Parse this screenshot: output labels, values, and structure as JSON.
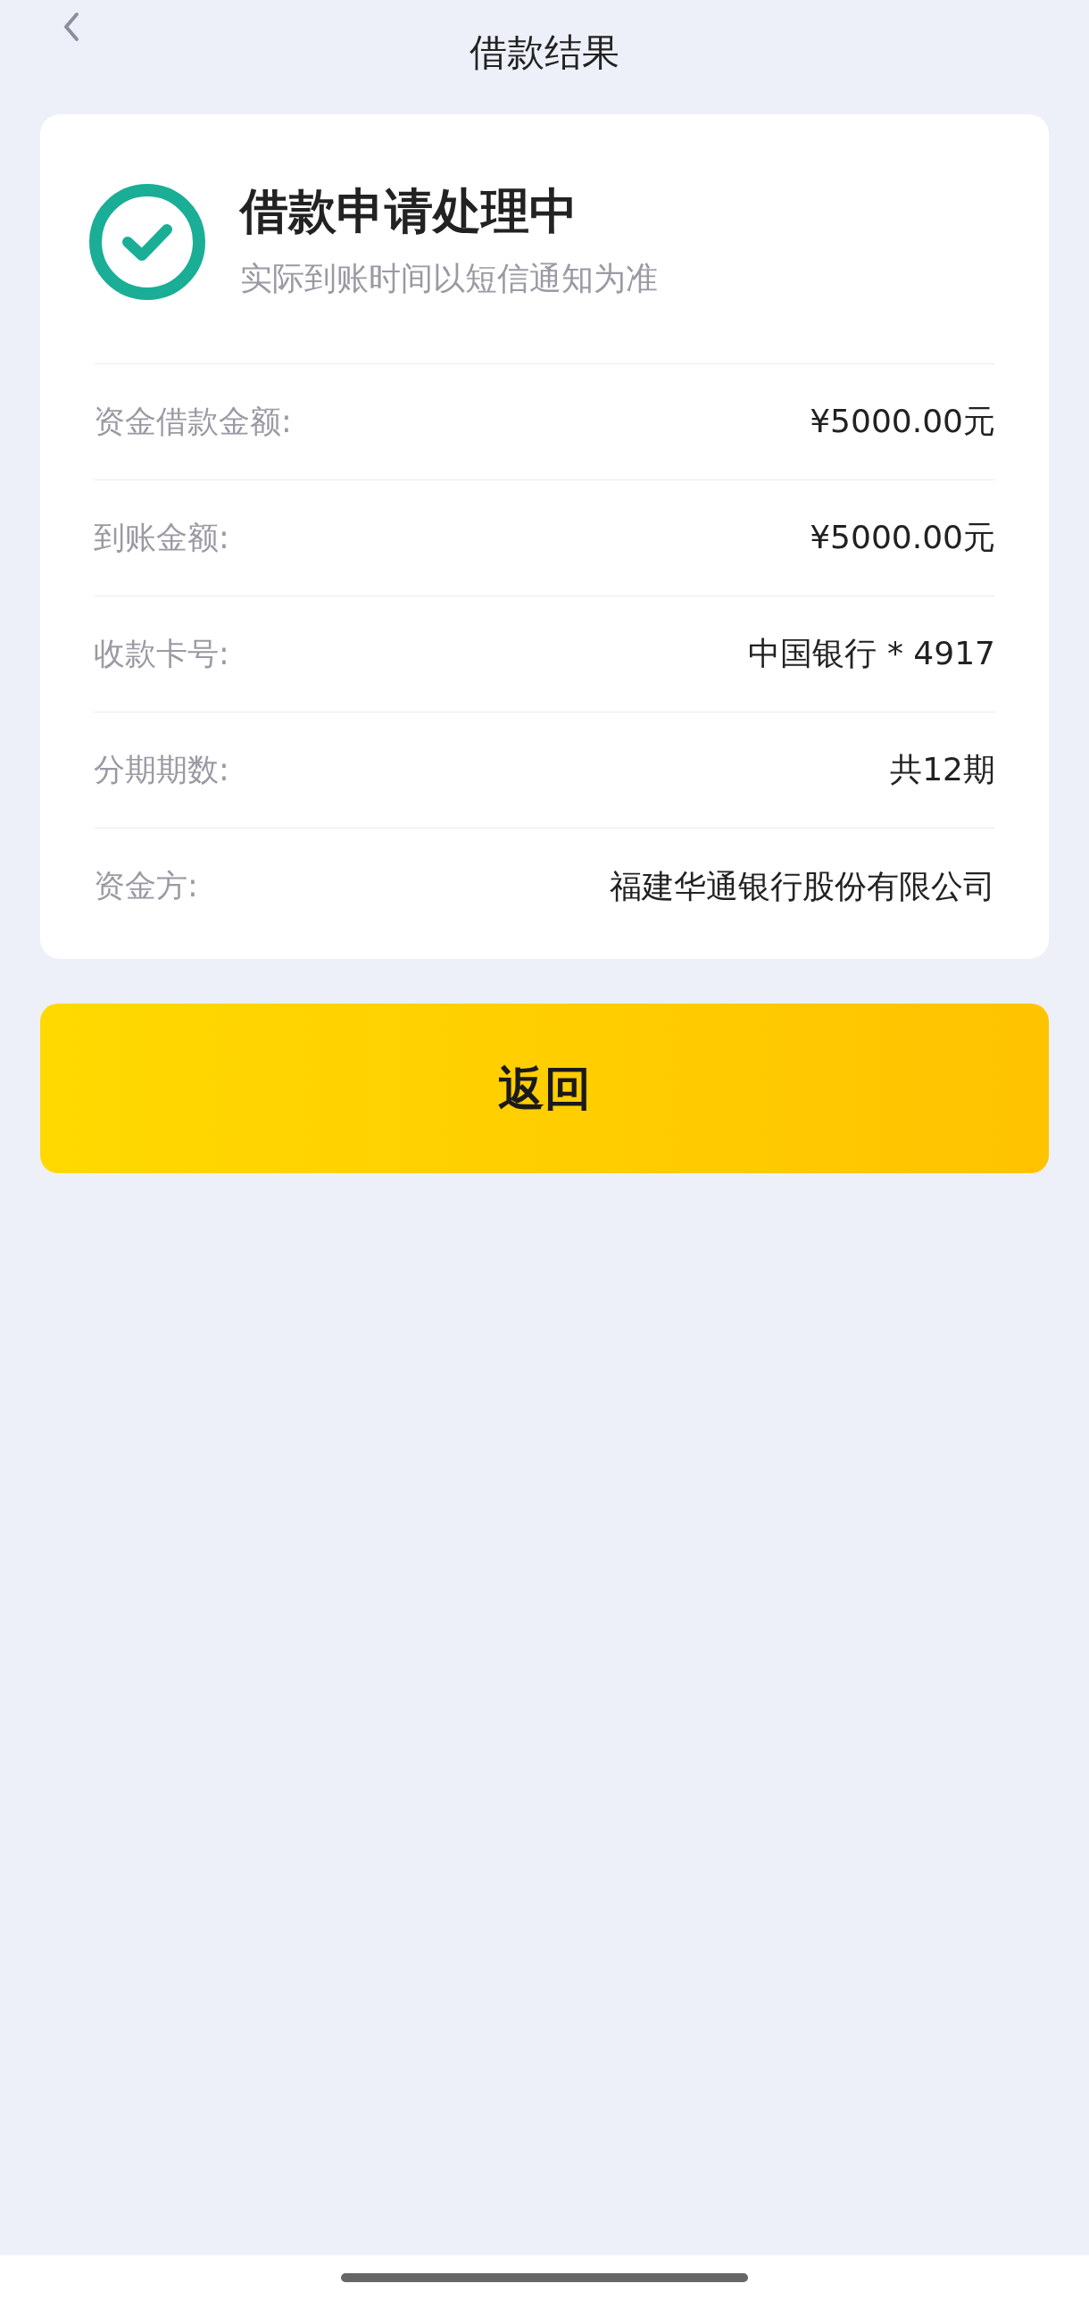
{
  "header": {
    "title": "借款结果"
  },
  "status": {
    "title": "借款申请处理中",
    "subtitle": "实际到账时间以短信通知为准"
  },
  "rows": [
    {
      "label": "资金借款金额:",
      "value": "¥5000.00元"
    },
    {
      "label": "到账金额:",
      "value": "¥5000.00元"
    },
    {
      "label": "收款卡号:",
      "value": "中国银行 * 4917"
    },
    {
      "label": "分期期数:",
      "value": "共12期"
    },
    {
      "label": "资金方:",
      "value": "福建华通银行股份有限公司"
    }
  ],
  "button": {
    "label": "返回"
  }
}
